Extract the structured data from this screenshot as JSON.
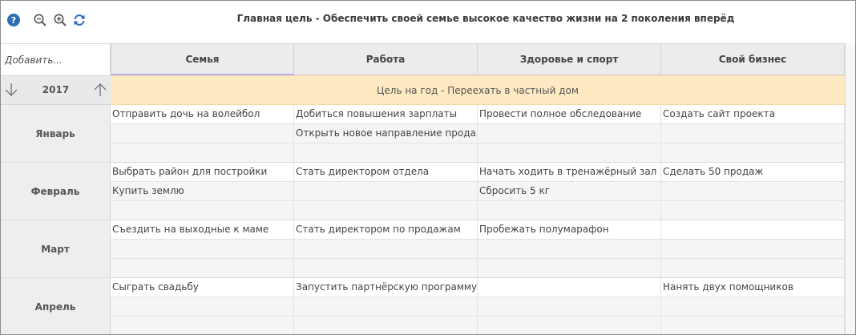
{
  "toolbar": {
    "help_icon": "help-circle",
    "zoom_out_icon": "zoom-out",
    "zoom_in_icon": "zoom-in",
    "refresh_icon": "refresh"
  },
  "goal_title": "Главная цель - Обеспечить своей семье высокое качество жизни на 2 поколения вперёд",
  "add_placeholder": "Добавить...",
  "columns": [
    "Семья",
    "Работа",
    "Здоровье и спорт",
    "Свой бизнес"
  ],
  "active_column": 0,
  "year": {
    "label": "2017",
    "goal": "Цель на год - Переехать в частный дом"
  },
  "months": [
    {
      "name": "Январь",
      "rows": [
        [
          "Отправить дочь на волейбол",
          "Добиться повышения зарплаты",
          "Провести полное обследование",
          "Создать сайт проекта"
        ],
        [
          "",
          "Открыть новое направление продаж",
          "",
          ""
        ],
        [
          "",
          "",
          "",
          ""
        ]
      ]
    },
    {
      "name": "Февраль",
      "rows": [
        [
          "Выбрать район для постройки",
          "Стать директором отдела",
          "Начать ходить в тренажёрный зал",
          "Сделать 50 продаж"
        ],
        [
          "Купить землю",
          "",
          "Сбросить 5 кг",
          ""
        ],
        [
          "",
          "",
          "",
          ""
        ]
      ]
    },
    {
      "name": "Март",
      "rows": [
        [
          "Съездить на выходные к маме",
          "Стать директором по продажам",
          "Пробежать полумарафон",
          ""
        ],
        [
          "",
          "",
          "",
          ""
        ],
        [
          "",
          "",
          "",
          ""
        ]
      ]
    },
    {
      "name": "Апрель",
      "rows": [
        [
          "Сыграть свадьбу",
          "Запустить партнёрскую программу",
          "",
          "Нанять двух помощников"
        ],
        [
          "",
          "",
          "",
          ""
        ],
        [
          "",
          "",
          "",
          ""
        ]
      ]
    }
  ],
  "colors": {
    "accent": "#2f6db5",
    "year_goal_bg": "#fde9c2",
    "active_tab_underline": "#b8b1ee"
  }
}
